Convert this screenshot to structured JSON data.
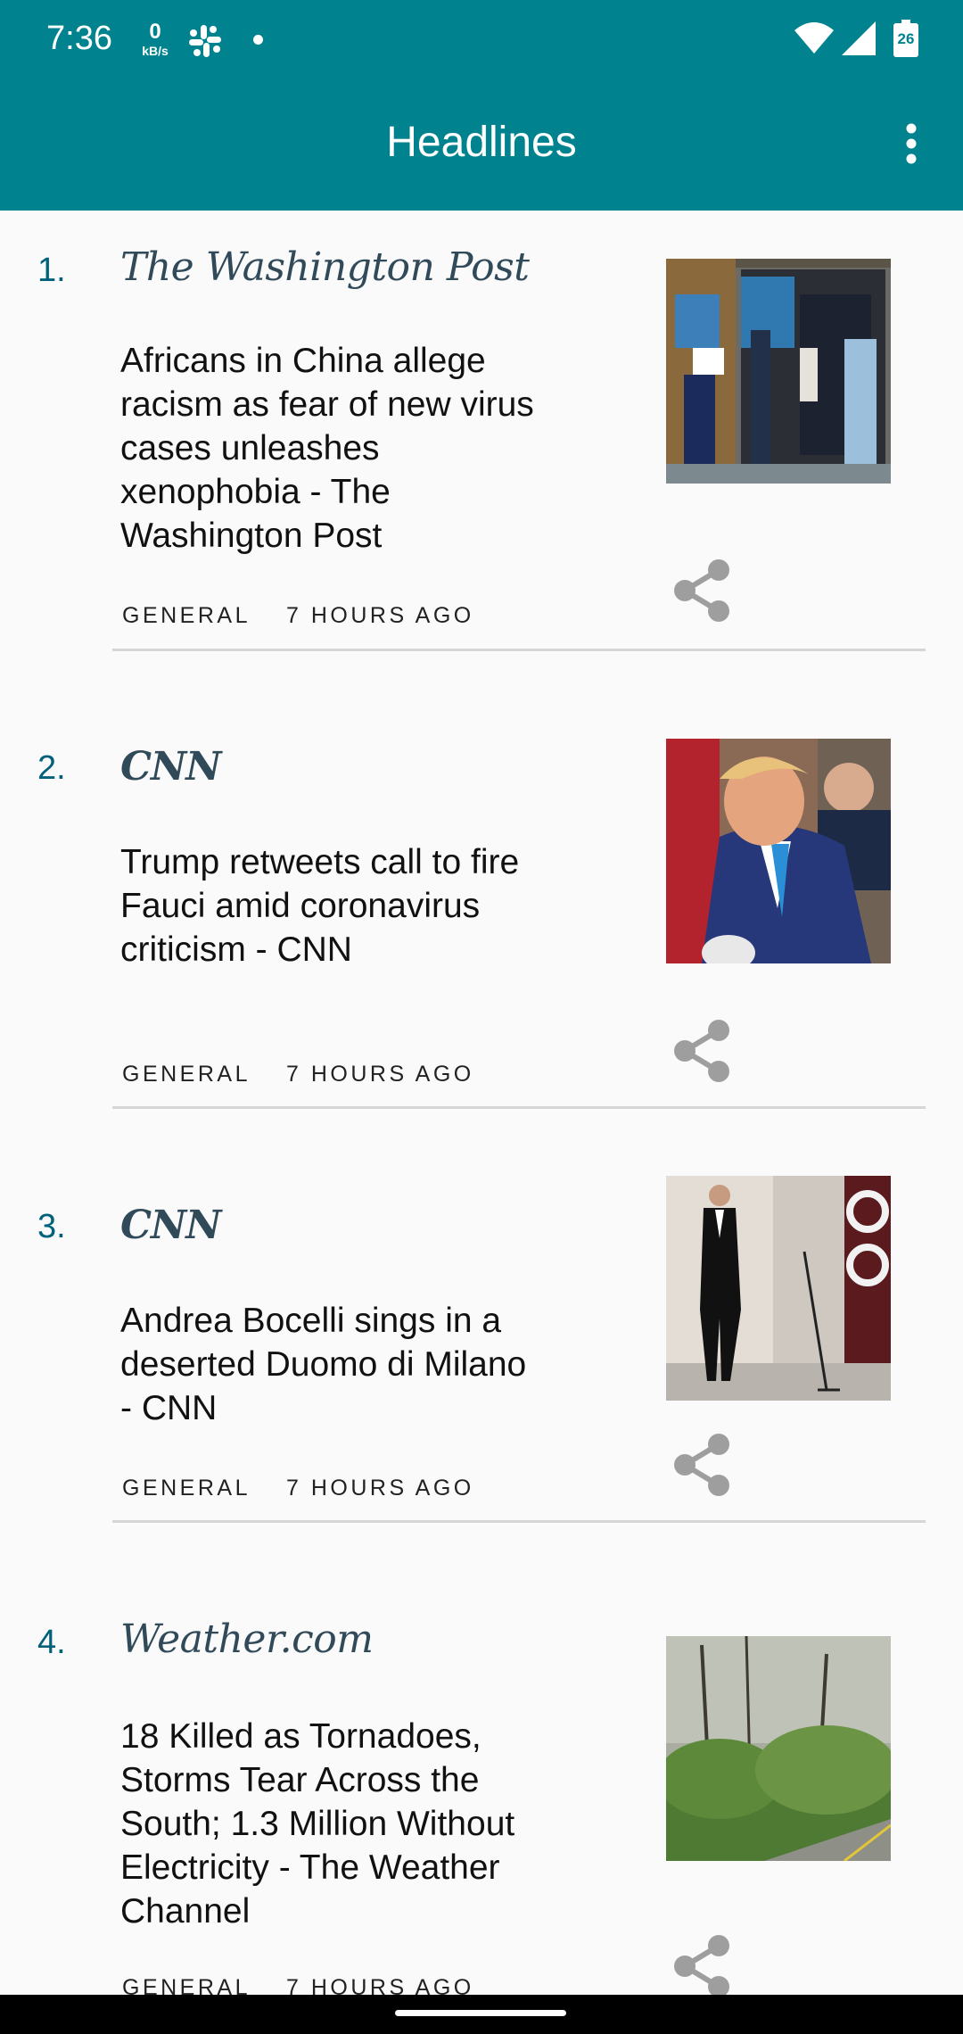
{
  "status_bar": {
    "time": "7:36",
    "net_speed_value": "0",
    "net_speed_unit": "kB/s",
    "battery_level": "26",
    "icons": [
      "slack-icon",
      "notification-dot-icon",
      "wifi-icon",
      "cell-signal-icon",
      "battery-icon"
    ]
  },
  "app_bar": {
    "title": "Headlines",
    "menu_icon": "more-vert-icon",
    "background_color": "#00838f"
  },
  "articles": [
    {
      "number": "1.",
      "source": "The Washington Post",
      "headline": "Africans in China allege racism as fear of new virus cases unleashes xenophobia - The Washington Post",
      "category": "GENERAL",
      "time_ago": "7 HOURS AGO",
      "image": "storefront-workers-in-protective-suits",
      "share_icon": "share-icon"
    },
    {
      "number": "2.",
      "source": "CNN",
      "headline": "Trump retweets call to fire Fauci amid coronavirus criticism - CNN",
      "category": "GENERAL",
      "time_ago": "7 HOURS AGO",
      "image": "trump-speaking",
      "share_icon": "share-icon"
    },
    {
      "number": "3.",
      "source": "CNN",
      "headline": "Andrea Bocelli sings in a deserted Duomo di Milano - CNN",
      "category": "GENERAL",
      "time_ago": "7 HOURS AGO",
      "image": "singer-before-cathedral",
      "share_icon": "share-icon"
    },
    {
      "number": "4.",
      "source": "Weather.com",
      "headline": "18 Killed as Tornadoes, Storms Tear Across the South; 1.3 Million Without Electricity - The Weather Channel",
      "category": "GENERAL",
      "time_ago": "7 HOURS AGO",
      "image": "storm-damaged-trees",
      "share_icon": "share-icon"
    }
  ],
  "colors": {
    "accent": "#00838f",
    "number": "#01617b",
    "source": "#314a5a",
    "share_icon": "#9e9e9e"
  }
}
